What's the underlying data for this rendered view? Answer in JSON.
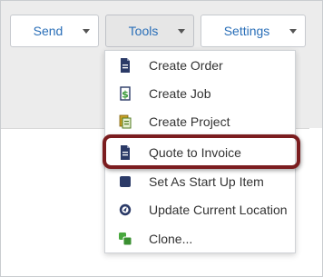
{
  "toolbar": {
    "send_label": "Send",
    "tools_label": "Tools",
    "settings_label": "Settings"
  },
  "tools_menu": {
    "items": [
      {
        "label": "Create Order",
        "icon": "document-icon"
      },
      {
        "label": "Create Job",
        "icon": "dollar-document-icon"
      },
      {
        "label": "Create Project",
        "icon": "project-icon"
      },
      {
        "label": "Quote to Invoice",
        "icon": "document-icon",
        "highlighted": true
      },
      {
        "label": "Set As Start Up Item",
        "icon": "square-icon"
      },
      {
        "label": "Update Current Location",
        "icon": "location-icon"
      },
      {
        "label": "Clone...",
        "icon": "clone-icon"
      }
    ]
  },
  "colors": {
    "accent": "#2a6fb8",
    "highlight_border": "#7b1d1f",
    "icon_navy": "#2b3a67",
    "icon_green": "#49a83e"
  }
}
